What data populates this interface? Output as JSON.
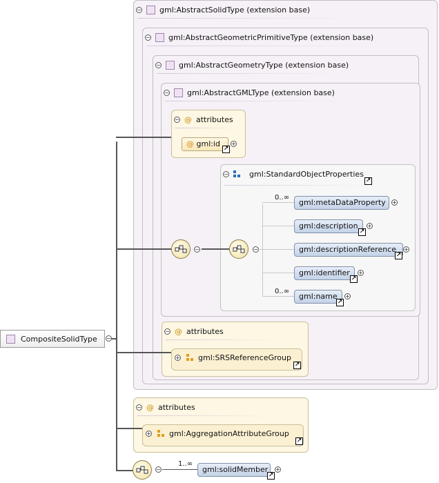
{
  "root": {
    "label": "CompositeSolidType"
  },
  "extensions": {
    "solid": "gml:AbstractSolidType (extension base)",
    "primitive": "gml:AbstractGeometricPrimitiveType (extension base)",
    "geometry": "gml:AbstractGeometryType (extension base)",
    "gml": "gml:AbstractGMLType (extension base)"
  },
  "gml_attributes": {
    "title": "attributes",
    "id": "gml:id"
  },
  "standard_object": {
    "title": "gml:StandardObjectProperties",
    "elements": [
      {
        "label": "gml:metaDataProperty",
        "cardinality": "0..∞"
      },
      {
        "label": "gml:description",
        "cardinality": ""
      },
      {
        "label": "gml:descriptionReference",
        "cardinality": ""
      },
      {
        "label": "gml:identifier",
        "cardinality": ""
      },
      {
        "label": "gml:name",
        "cardinality": "0..∞"
      }
    ]
  },
  "geometry_attributes": {
    "title": "attributes",
    "group": "gml:SRSReferenceGroup"
  },
  "aggregation_attributes": {
    "title": "attributes",
    "group": "gml:AggregationAttributeGroup"
  },
  "solid_member": {
    "label": "gml:solidMember",
    "cardinality": "1..∞"
  },
  "colors": {
    "extension_bg": "#f6f1f7",
    "attributes_bg": "#fdf7e3",
    "element_pill": "#c4d3e8",
    "accent_orange": "#e39b1b"
  }
}
